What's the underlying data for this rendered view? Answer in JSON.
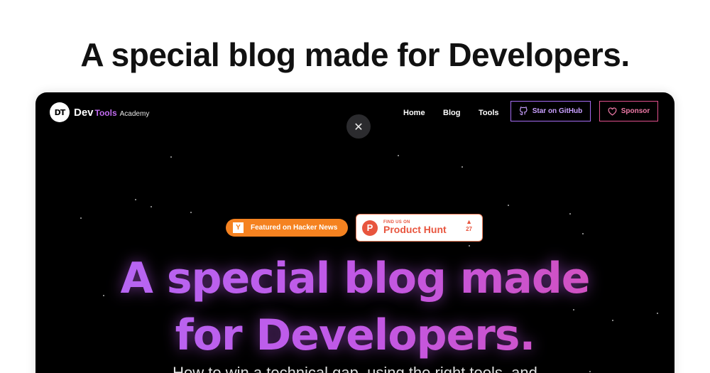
{
  "page": {
    "heading": "A special blog made for Developers."
  },
  "nav": {
    "logo_mark": "DT",
    "logo_dev": "Dev",
    "logo_tools": "Tools",
    "logo_academy": "Academy",
    "links": [
      "Home",
      "Blog",
      "Tools"
    ],
    "github_button": "Star on GitHub",
    "sponsor_button": "Sponsor"
  },
  "overlay": {
    "close_label": "✕"
  },
  "badges": {
    "hacker_news_icon": "Y",
    "hacker_news_text": "Featured on Hacker News",
    "product_hunt_icon": "P",
    "product_hunt_small": "FIND US ON",
    "product_hunt_big": "Product Hunt",
    "product_hunt_arrow": "▲",
    "product_hunt_count": "27"
  },
  "hero": {
    "line1": "A special blog made",
    "line2": "for Developers."
  },
  "subtitle": "How to win a technical gap, using the right tools, and",
  "colors": {
    "accent_purple": "#b36af7",
    "accent_pink": "#d64fb5",
    "hacker_news_orange": "#f58220",
    "product_hunt_red": "#e8553e"
  },
  "icons": {
    "github": "github-icon",
    "sponsor": "heart-icon",
    "close": "close-icon"
  }
}
